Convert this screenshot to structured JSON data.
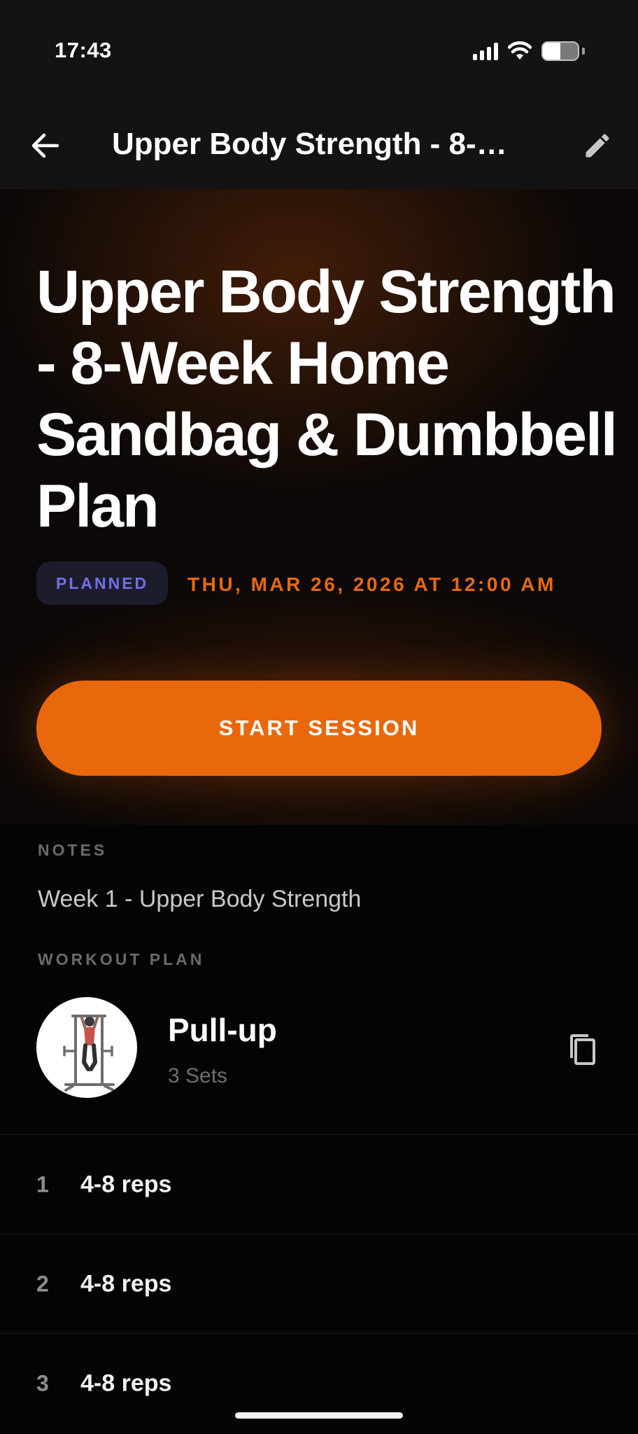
{
  "status_bar": {
    "time": "17:43"
  },
  "app_bar": {
    "title": "Upper Body Strength - 8-Week Home Sandbag & Dumbbell Plan"
  },
  "hero": {
    "title": "Upper Body Strength - 8-Week Home Sandbag & Dumbbell Plan",
    "status_badge": "PLANNED",
    "date": "THU, MAR 26, 2026 AT 12:00 AM",
    "start_label": "START SESSION"
  },
  "notes": {
    "label": "NOTES",
    "text": "Week 1 - Upper Body Strength"
  },
  "workout_plan": {
    "label": "WORKOUT PLAN",
    "exercise": {
      "name": "Pull-up",
      "sets_label": "3 Sets"
    },
    "sets": [
      {
        "number": "1",
        "reps": "4-8 reps"
      },
      {
        "number": "2",
        "reps": "4-8 reps"
      },
      {
        "number": "3",
        "reps": "4-8 reps"
      }
    ]
  },
  "colors": {
    "accent": "#e9680c",
    "badge_text": "#7170e8",
    "badge_bg": "#1d1c2c",
    "background": "#040405"
  },
  "icons": {
    "back": "arrow-left-icon",
    "edit": "pencil-icon",
    "copy": "copy-icon",
    "wifi": "wifi-icon",
    "signal": "cellular-signal-icon",
    "battery": "battery-icon"
  },
  "battery_level": 0.5
}
